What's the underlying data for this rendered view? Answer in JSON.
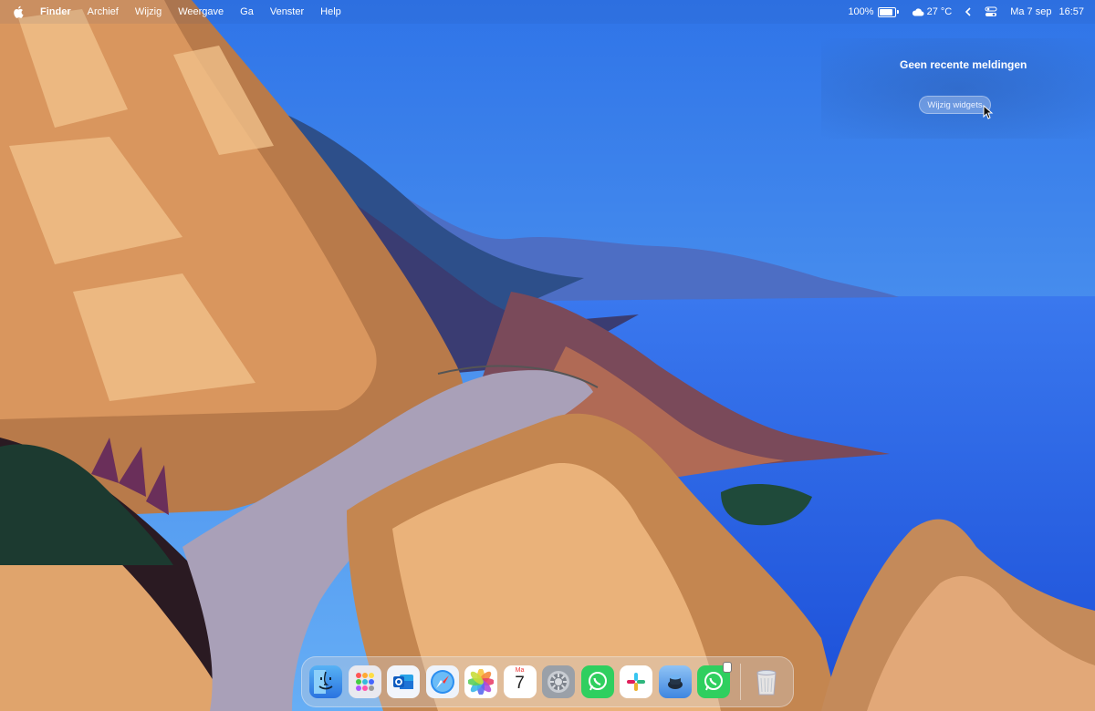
{
  "menubar": {
    "apple_icon": "apple-logo-icon",
    "app_name": "Finder",
    "menus": [
      "Archief",
      "Wijzig",
      "Weergave",
      "Ga",
      "Venster",
      "Help"
    ],
    "battery_percent": "100%",
    "battery_level": 1.0,
    "weather": "27 °C",
    "weather_icon": "cloud-icon",
    "chevron_icon": "chevron-left-icon",
    "control_center_icon": "control-center-icon",
    "date": "Ma 7 sep",
    "time": "16:57"
  },
  "notifications": {
    "title": "Geen recente meldingen",
    "edit_widgets_label": "Wijzig widgets"
  },
  "dock": {
    "apps": [
      {
        "name": "Finder",
        "icon": "finder-icon"
      },
      {
        "name": "Launchpad",
        "icon": "launchpad-icon"
      },
      {
        "name": "Outlook",
        "icon": "outlook-icon"
      },
      {
        "name": "Safari",
        "icon": "safari-icon"
      },
      {
        "name": "Foto's",
        "icon": "photos-icon"
      },
      {
        "name": "Agenda",
        "icon": "calendar-icon"
      },
      {
        "name": "Systeeminstellingen",
        "icon": "settings-gear-icon"
      },
      {
        "name": "WhatsApp",
        "icon": "whatsapp-icon"
      },
      {
        "name": "Slack",
        "icon": "slack-icon"
      },
      {
        "name": "Xcode",
        "icon": "app-icon"
      },
      {
        "name": "WhatsApp",
        "icon": "whatsapp-icon"
      }
    ],
    "calendar_day": "Ma",
    "calendar_date": "7",
    "trash_icon": "trash-icon"
  },
  "colors": {
    "sky": "#4a95f0",
    "sea": "#2f64e6",
    "cliff_light": "#e8b07c",
    "cliff_dark": "#8a5a3a",
    "road": "#a9a0b8"
  }
}
